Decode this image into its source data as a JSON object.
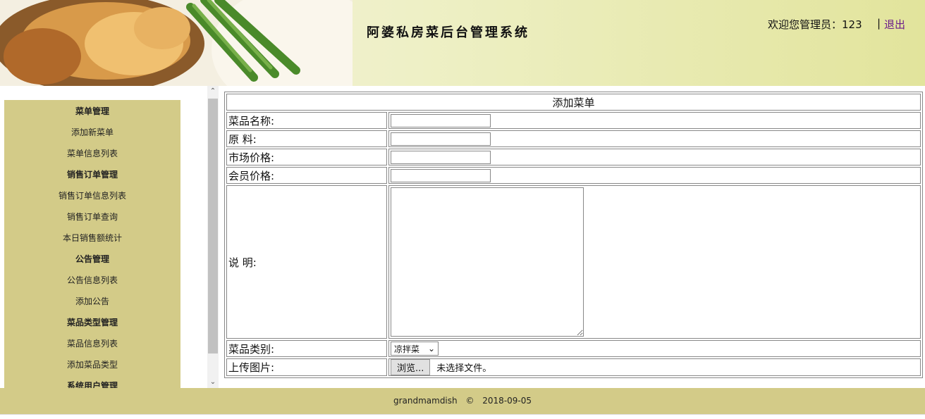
{
  "header": {
    "title": "阿婆私房菜后台管理系统",
    "welcome": "欢迎您管理员：123",
    "separator": "|",
    "logout": "退出"
  },
  "sidebar": {
    "items": [
      {
        "label": "菜单管理",
        "heading": true
      },
      {
        "label": "添加新菜单",
        "heading": false
      },
      {
        "label": "菜单信息列表",
        "heading": false
      },
      {
        "label": "销售订单管理",
        "heading": true
      },
      {
        "label": "销售订单信息列表",
        "heading": false
      },
      {
        "label": "销售订单查询",
        "heading": false
      },
      {
        "label": "本日销售额统计",
        "heading": false
      },
      {
        "label": "公告管理",
        "heading": true
      },
      {
        "label": "公告信息列表",
        "heading": false
      },
      {
        "label": "添加公告",
        "heading": false
      },
      {
        "label": "菜品类型管理",
        "heading": true
      },
      {
        "label": "菜品信息列表",
        "heading": false
      },
      {
        "label": "添加菜品类型",
        "heading": false
      },
      {
        "label": "系统用户管理",
        "heading": true
      }
    ]
  },
  "form": {
    "caption": "添加菜单",
    "fields": {
      "name": "菜品名称:",
      "ingredients": "原 料:",
      "market_price": "市场价格:",
      "member_price": "会员价格:",
      "description": "说 明:",
      "category": "菜品类别:",
      "upload": "上传图片:"
    },
    "category_selected": "凉拌菜",
    "browse_button": "浏览...",
    "file_status": "未选择文件。"
  },
  "footer": {
    "site": "grandmamdish",
    "copyright": "©",
    "date": "2018-09-05"
  },
  "colors": {
    "sidebar_bg": "#d3cb88",
    "footer_bg": "#d3cb88",
    "logout_link": "#6b1b8a"
  }
}
